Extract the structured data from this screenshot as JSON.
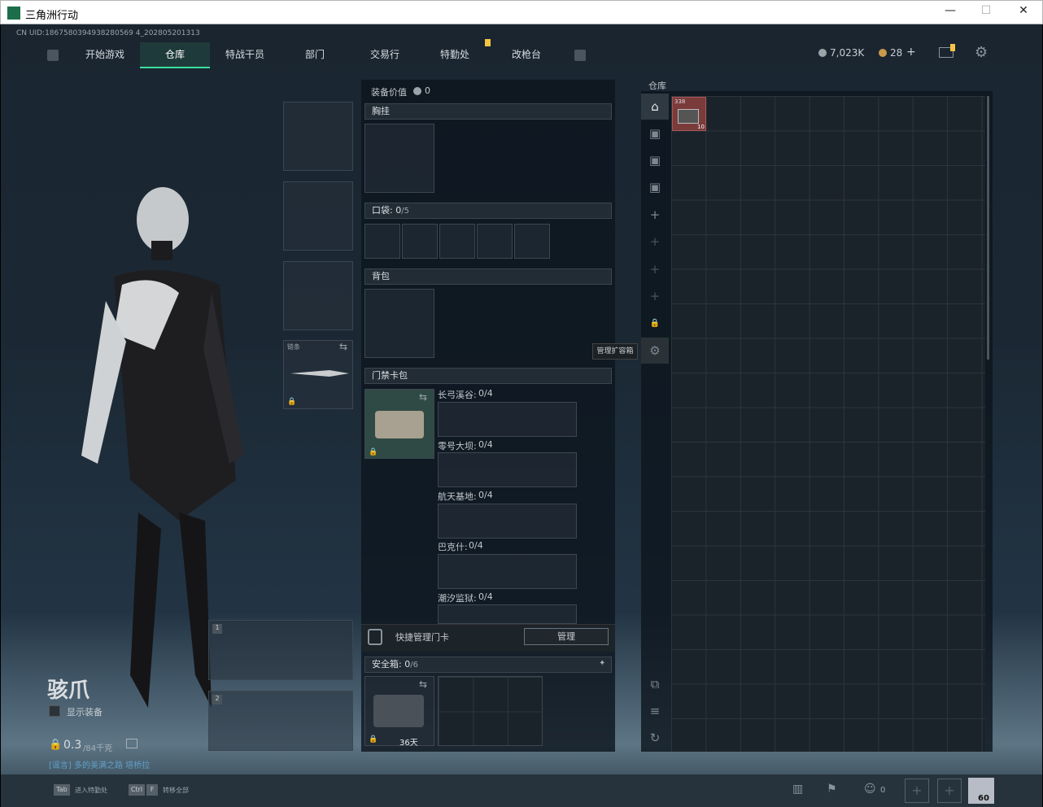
{
  "window": {
    "title": "三角洲行动",
    "min": "—",
    "max": "☐",
    "close": "✕"
  },
  "uid": "CN UID:1867580394938280569 4_202805201313",
  "nav": {
    "tabs": [
      "开始游戏",
      "仓库",
      "特战干员",
      "部门",
      "交易行",
      "特勤处",
      "改枪台"
    ],
    "active": "仓库"
  },
  "currency": {
    "coins": "7,023K",
    "tickets": "28",
    "plus": "+"
  },
  "character": {
    "name": "骇爪",
    "show_gear": "显示装备",
    "weight_value": "0.3",
    "weight_max": "/84千克",
    "subtitle": "[谣言] 多的美满之路 塔桥拉"
  },
  "loadout": {
    "melee_label": "链条",
    "slot1": "1",
    "slot2": "2"
  },
  "equipment": {
    "value_label": "装备价值",
    "value": "0",
    "chest_rig": "胸挂",
    "pocket_label": "口袋:",
    "pocket_count": "0",
    "pocket_max": "/5",
    "backpack": "背包",
    "keycard_pack": "门禁卡包",
    "keycard_maps": [
      {
        "name": "长弓溪谷:",
        "count": "0/4"
      },
      {
        "name": "零号大坝:",
        "count": "0/4"
      },
      {
        "name": "航天基地:",
        "count": "0/4"
      },
      {
        "name": "巴克什:",
        "count": "0/4"
      },
      {
        "name": "潮汐监狱:",
        "count": "0/4"
      }
    ],
    "quick_manage": "快捷管理门卡",
    "manage_btn": "管理",
    "safebox_label": "安全箱:",
    "safebox_count": "0",
    "safebox_max": "/6",
    "safebox_time": "36天"
  },
  "stash": {
    "title": "仓库",
    "tooltip": "管理扩容箱",
    "item_tag": "338",
    "item_count": "10"
  },
  "bottom": {
    "tab_key": "Tab",
    "tab_hint": "进入特勤处",
    "ctrl_key": "Ctrl",
    "f_key": "F",
    "ctrl_hint": "转移全部",
    "friends": "0",
    "level": "60"
  },
  "colors": {
    "accent": "#37e0a1",
    "item_bg": "#7a3b3b"
  }
}
